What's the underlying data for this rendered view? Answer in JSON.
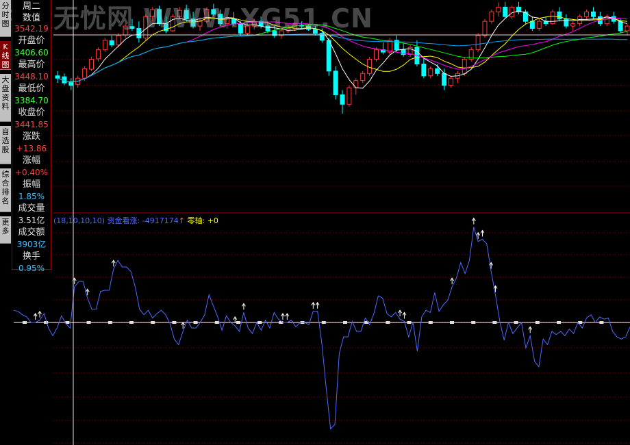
{
  "watermark": "牛股无忧网 WWW.XG51.CN",
  "tabs": [
    "分时图",
    "K线图",
    "大盘资料",
    "自选股",
    "综合排名",
    "更多"
  ],
  "info": {
    "weekday": "周二",
    "title": "数值",
    "rows": [
      {
        "label": "",
        "value": "3542.19",
        "color": "#ff4040"
      },
      {
        "label": "开盘价",
        "value": "3406.60",
        "color": "#40ff40"
      },
      {
        "label": "最高价",
        "value": "3448.10",
        "color": "#ff4040"
      },
      {
        "label": "最低价",
        "value": "3384.70",
        "color": "#40ff40"
      },
      {
        "label": "收盘价",
        "value": "3441.85",
        "color": "#ff4040"
      },
      {
        "label": "涨跌",
        "value": "+13.86",
        "color": "#ff4040"
      },
      {
        "label": "涨幅",
        "value": "+0.40%",
        "color": "#ff4040"
      },
      {
        "label": "振幅",
        "value": "1.85%",
        "color": "#40c0ff"
      },
      {
        "label": "成交量",
        "value": "3.51亿",
        "color": "#e0e0e0"
      },
      {
        "label": "成交额",
        "value": "3903亿",
        "color": "#40c0ff"
      },
      {
        "label": "换手",
        "value": "0.95%",
        "color": "#40c0ff"
      }
    ]
  },
  "legend": {
    "params": "(18,10,10,10)",
    "name": "资金看涨:",
    "value": "-4917174",
    "arrow": "↑",
    "zero_label": "零轴:",
    "zero_value": "+0"
  },
  "colors": {
    "up": "#ff3a3a",
    "down": "#00ffff",
    "line": "#4d6bff",
    "grid": "#7a0000",
    "zero": "#ffffff",
    "arrow": "#ffffff",
    "ma": [
      "#ffffff",
      "#ffff00",
      "#ff00ff",
      "#00ff00",
      "#00a0ff"
    ]
  },
  "chart_data": [
    {
      "type": "candlestick",
      "title": "",
      "ylim": [
        3300,
        3560
      ],
      "ohlc": [
        [
          3400,
          3410,
          3385,
          3395
        ],
        [
          3398,
          3405,
          3380,
          3385
        ],
        [
          3388,
          3395,
          3370,
          3380
        ],
        [
          3382,
          3400,
          3375,
          3395
        ],
        [
          3395,
          3420,
          3390,
          3415
        ],
        [
          3414,
          3440,
          3410,
          3435
        ],
        [
          3436,
          3460,
          3430,
          3455
        ],
        [
          3455,
          3480,
          3450,
          3475
        ],
        [
          3474,
          3485,
          3460,
          3465
        ],
        [
          3465,
          3490,
          3460,
          3485
        ],
        [
          3486,
          3510,
          3480,
          3505
        ],
        [
          3504,
          3520,
          3495,
          3500
        ],
        [
          3500,
          3515,
          3470,
          3480
        ],
        [
          3480,
          3530,
          3475,
          3525
        ],
        [
          3525,
          3545,
          3515,
          3540
        ],
        [
          3540,
          3548,
          3505,
          3510
        ],
        [
          3510,
          3525,
          3490,
          3495
        ],
        [
          3495,
          3530,
          3492,
          3525
        ],
        [
          3525,
          3545,
          3520,
          3538
        ],
        [
          3538,
          3550,
          3515,
          3520
        ],
        [
          3520,
          3535,
          3500,
          3505
        ],
        [
          3505,
          3520,
          3495,
          3515
        ],
        [
          3515,
          3545,
          3512,
          3540
        ],
        [
          3540,
          3552,
          3525,
          3530
        ],
        [
          3530,
          3540,
          3505,
          3510
        ],
        [
          3510,
          3525,
          3500,
          3520
        ],
        [
          3520,
          3535,
          3505,
          3510
        ],
        [
          3510,
          3515,
          3485,
          3490
        ],
        [
          3490,
          3510,
          3485,
          3505
        ],
        [
          3505,
          3520,
          3498,
          3515
        ],
        [
          3515,
          3525,
          3500,
          3505
        ],
        [
          3505,
          3512,
          3490,
          3495
        ],
        [
          3495,
          3505,
          3480,
          3485
        ],
        [
          3485,
          3500,
          3478,
          3495
        ],
        [
          3495,
          3508,
          3490,
          3500
        ],
        [
          3500,
          3512,
          3495,
          3507
        ],
        [
          3507,
          3515,
          3500,
          3505
        ],
        [
          3505,
          3510,
          3495,
          3498
        ],
        [
          3498,
          3505,
          3485,
          3490
        ],
        [
          3490,
          3500,
          3470,
          3475
        ],
        [
          3475,
          3480,
          3400,
          3410
        ],
        [
          3410,
          3420,
          3350,
          3360
        ],
        [
          3360,
          3370,
          3320,
          3340
        ],
        [
          3340,
          3380,
          3335,
          3375
        ],
        [
          3375,
          3395,
          3360,
          3390
        ],
        [
          3390,
          3410,
          3385,
          3405
        ],
        [
          3405,
          3440,
          3400,
          3435
        ],
        [
          3435,
          3460,
          3430,
          3455
        ],
        [
          3455,
          3470,
          3445,
          3450
        ],
        [
          3450,
          3480,
          3445,
          3475
        ],
        [
          3475,
          3485,
          3450,
          3455
        ],
        [
          3455,
          3470,
          3440,
          3445
        ],
        [
          3445,
          3465,
          3440,
          3460
        ],
        [
          3460,
          3475,
          3420,
          3425
        ],
        [
          3425,
          3440,
          3395,
          3400
        ],
        [
          3400,
          3420,
          3395,
          3415
        ],
        [
          3415,
          3425,
          3400,
          3405
        ],
        [
          3405,
          3415,
          3370,
          3380
        ],
        [
          3380,
          3400,
          3375,
          3395
        ],
        [
          3395,
          3410,
          3385,
          3405
        ],
        [
          3405,
          3440,
          3400,
          3435
        ],
        [
          3435,
          3460,
          3430,
          3455
        ],
        [
          3455,
          3490,
          3450,
          3485
        ],
        [
          3485,
          3520,
          3480,
          3515
        ],
        [
          3515,
          3540,
          3510,
          3535
        ],
        [
          3535,
          3555,
          3525,
          3545
        ],
        [
          3545,
          3556,
          3520,
          3525
        ],
        [
          3525,
          3548,
          3520,
          3545
        ],
        [
          3545,
          3556,
          3530,
          3535
        ],
        [
          3535,
          3540,
          3510,
          3515
        ],
        [
          3515,
          3525,
          3495,
          3500
        ],
        [
          3500,
          3520,
          3495,
          3515
        ],
        [
          3515,
          3525,
          3505,
          3510
        ],
        [
          3510,
          3540,
          3508,
          3535
        ],
        [
          3535,
          3545,
          3515,
          3520
        ],
        [
          3520,
          3530,
          3500,
          3505
        ],
        [
          3505,
          3515,
          3495,
          3510
        ],
        [
          3510,
          3530,
          3505,
          3525
        ],
        [
          3525,
          3540,
          3520,
          3535
        ],
        [
          3535,
          3545,
          3520,
          3525
        ],
        [
          3525,
          3535,
          3505,
          3510
        ],
        [
          3510,
          3530,
          3505,
          3525
        ],
        [
          3525,
          3535,
          3510,
          3515
        ],
        [
          3515,
          3520,
          3490,
          3495
        ],
        [
          3495,
          3510,
          3485,
          3505
        ]
      ],
      "ma_periods": [
        5,
        10,
        20,
        30,
        60
      ]
    },
    {
      "type": "line",
      "title": "",
      "ylim": [
        -1,
        1
      ],
      "series": [
        {
          "values": [
            0.11,
            0.1,
            0.07,
            0.05,
            0.0,
            0.0,
            0.02,
            0.08,
            -0.05,
            -0.12,
            -0.05,
            0.06,
            -0.01,
            -0.05,
            0.32,
            0.37,
            0.37,
            0.22,
            0.12,
            0.12,
            0.28,
            0.29,
            0.29,
            0.48,
            0.56,
            0.5,
            0.5,
            0.46,
            0.32,
            0.12,
            0.07,
            0.11,
            0.04,
            0.08,
            0.11,
            0.07,
            -0.01,
            -0.15,
            -0.2,
            -0.08,
            0.02,
            -0.05,
            -0.05,
            0.0,
            0.07,
            0.25,
            0.15,
            0.05,
            -0.07,
            0.06,
            0.0,
            -0.03,
            -0.08,
            0.09,
            -0.05,
            -0.1,
            0.0,
            -0.07,
            0.02,
            -0.05,
            0.09,
            0.03,
            0.0,
            0.0,
            0.02,
            -0.04,
            0.0,
            0.0,
            -0.02,
            0.1,
            0.1,
            -0.19,
            -0.59,
            -0.96,
            -0.92,
            -0.28,
            -0.13,
            -0.13,
            0.01,
            -0.08,
            -0.08,
            0.04,
            -0.02,
            0.08,
            0.24,
            0.22,
            0.08,
            0.05,
            0.09,
            0.03,
            0.01,
            -0.13,
            0.0,
            -0.26,
            0.05,
            0.11,
            0.09,
            0.27,
            0.1,
            0.16,
            0.2,
            0.32,
            0.4,
            0.54,
            0.44,
            0.56,
            0.86,
            0.73,
            0.75,
            0.71,
            0.46,
            0.25,
            0.01,
            -0.16,
            0.0,
            -0.1,
            -0.05,
            0.0,
            -0.23,
            -0.12,
            -0.35,
            -0.4,
            -0.15,
            -0.2,
            -0.08,
            -0.11,
            -0.08,
            -0.12,
            -0.06,
            -0.1,
            0.0,
            -0.05,
            0.04,
            0.07,
            0.0,
            0.05,
            0.03,
            0.04,
            -0.08,
            -0.13,
            -0.15,
            -0.13,
            -0.04
          ]
        }
      ],
      "zero": 0,
      "arrows": [
        5,
        6,
        14,
        17,
        23,
        39,
        51,
        53,
        62,
        63,
        69,
        70,
        89,
        90,
        101,
        106,
        107,
        108,
        110,
        111,
        119,
        144,
        145,
        157
      ],
      "markers": [
        0,
        6,
        12,
        18,
        24,
        30,
        36,
        42,
        48,
        54,
        60,
        66,
        72,
        78,
        84,
        90,
        96,
        102,
        108,
        114,
        120,
        126,
        132,
        138,
        144,
        150,
        156,
        162
      ]
    }
  ]
}
